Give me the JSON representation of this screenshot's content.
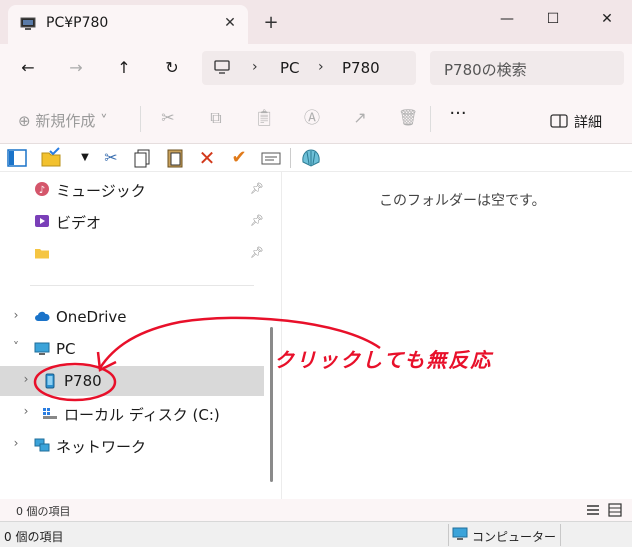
{
  "window": {
    "tab_title": "PC¥P780",
    "tab_close": "✕",
    "new_tab": "+",
    "minimize": "—",
    "maximize": "☐",
    "close": "✕"
  },
  "address": {
    "back": "←",
    "forward": "→",
    "up": "↑",
    "refresh": "↻",
    "sep": "›",
    "crumbs": [
      "PC",
      "P780"
    ],
    "search_placeholder": "P780の検索"
  },
  "commandbar": {
    "new_label": "⊕ 新規作成 ˅",
    "more": "···",
    "details_label": "詳細"
  },
  "nav": {
    "items": [
      {
        "label": "ミュージック",
        "icon": "music-icon",
        "pinned": true
      },
      {
        "label": "ビデオ",
        "icon": "video-icon",
        "pinned": true
      },
      {
        "label": "",
        "icon": "folder-icon",
        "pinned": true
      },
      {
        "label": "OneDrive",
        "icon": "cloud-icon",
        "chevron": "›"
      },
      {
        "label": "PC",
        "icon": "pc-icon",
        "chevron": "˅"
      },
      {
        "label": "P780",
        "icon": "phone-icon",
        "chevron": "›",
        "selected": true
      },
      {
        "label": "ローカル ディスク (C:)",
        "icon": "drive-icon",
        "chevron": "›"
      },
      {
        "label": "ネットワーク",
        "icon": "network-icon",
        "chevron": "›"
      }
    ]
  },
  "main": {
    "empty_message": "このフォルダーは空です。"
  },
  "status": {
    "count": "0 個の項目",
    "count2": "0 個の項目",
    "location": "コンピューター"
  },
  "annotation": {
    "text": "クリックしても無反応"
  },
  "colors": {
    "accent": "#1a73c9",
    "annotation_red": "#e8102a",
    "selected_bg": "#d9d9d9",
    "titlebar": "#f2e6e8"
  }
}
